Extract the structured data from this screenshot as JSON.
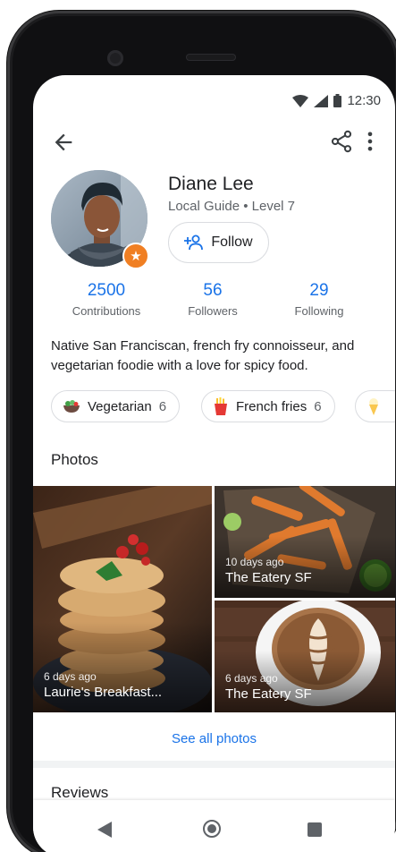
{
  "status_bar": {
    "time": "12:30",
    "icons": [
      "wifi-icon",
      "signal-icon",
      "battery-icon"
    ]
  },
  "app_bar": {
    "icons": [
      "back-arrow-icon",
      "share-icon",
      "more-vert-icon"
    ]
  },
  "profile": {
    "name": "Diane Lee",
    "level": "Local Guide • Level 7",
    "follow_label": "Follow",
    "badge_icon": "star-icon"
  },
  "stats": [
    {
      "value": "2500",
      "label": "Contributions"
    },
    {
      "value": "56",
      "label": "Followers"
    },
    {
      "value": "29",
      "label": "Following"
    }
  ],
  "bio": "Native San Franciscan, french fry connoisseur, and vegetarian foodie with a love for spicy food.",
  "chips": [
    {
      "icon": "salad-icon",
      "label": "Vegetarian",
      "count": "6"
    },
    {
      "icon": "fries-icon",
      "label": "French fries",
      "count": "6"
    },
    {
      "icon": "ice-cream-icon",
      "label": "",
      "count": ""
    }
  ],
  "photos_section": {
    "title": "Photos",
    "see_all": "See all photos"
  },
  "photos": [
    {
      "time": "6 days ago",
      "place": "Laurie's Breakfast..."
    },
    {
      "time": "10 days ago",
      "place": "The Eatery SF"
    },
    {
      "time": "6 days ago",
      "place": "The Eatery SF"
    }
  ],
  "reviews_section": {
    "title": "Reviews"
  },
  "colors": {
    "accent": "#1a73e8",
    "badge": "#f07f23",
    "text": "#202124",
    "secondary": "#5f6368"
  }
}
